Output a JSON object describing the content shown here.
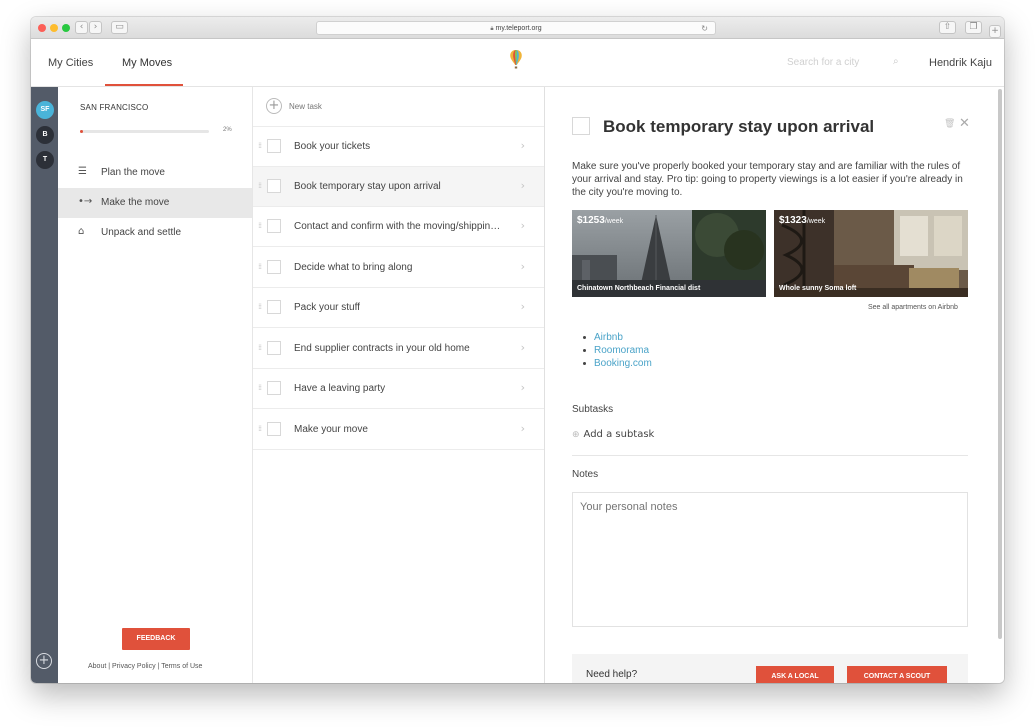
{
  "browser": {
    "url": "my.teleport.org",
    "lock_icon": "lock-icon",
    "reload_icon": "reload-icon"
  },
  "header": {
    "tabs": [
      {
        "label": "My Cities"
      },
      {
        "label": "My Moves"
      }
    ],
    "active_tab": "My Moves",
    "search_placeholder": "Search for a city",
    "user": "Hendrik Kaju"
  },
  "rail": {
    "cities": [
      "SF",
      "B",
      "T"
    ]
  },
  "city": {
    "name": "SAN FRANCISCO",
    "progress_pct": "2%",
    "progress_value": 2,
    "phases": [
      {
        "label": "Plan the move",
        "icon": "list-icon"
      },
      {
        "label": "Make the move",
        "icon": "arrow-icon"
      },
      {
        "label": "Unpack and settle",
        "icon": "home-icon"
      }
    ],
    "active_phase": "Make the move",
    "feedback": "FEEDBACK",
    "footer": {
      "about": "About",
      "privacy": "Privacy Policy",
      "terms": "Terms of Use"
    }
  },
  "tasks": {
    "new_task": "New task",
    "items": [
      {
        "label": "Book your tickets"
      },
      {
        "label": "Book temporary stay upon arrival"
      },
      {
        "label": "Contact and confirm with the moving/shipping company"
      },
      {
        "label": "Decide what to bring along"
      },
      {
        "label": "Pack your stuff"
      },
      {
        "label": "End supplier contracts in your old home"
      },
      {
        "label": "Have a leaving party"
      },
      {
        "label": "Make your move"
      }
    ],
    "active_index": 1
  },
  "detail": {
    "title": "Book temporary stay upon arrival",
    "description": "Make sure you've properly booked your temporary stay and are familiar with the rules of your arrival and stay. Pro tip: going to property viewings is a lot easier if you're already in the city you're moving to.",
    "apartments": [
      {
        "price": "$1253",
        "per": "/week",
        "caption": "Chinatown Northbeach Financial dist"
      },
      {
        "price": "$1323",
        "per": "/week",
        "caption": "Whole sunny Soma loft"
      }
    ],
    "see_all": "See all apartments on Airbnb",
    "links": [
      "Airbnb",
      "Roomorama",
      "Booking.com"
    ],
    "subtasks_heading": "Subtasks",
    "add_subtask": "Add a subtask",
    "notes_heading": "Notes",
    "notes_placeholder": "Your personal notes",
    "help": {
      "label": "Need help?",
      "ask_local": "ASK A LOCAL",
      "contact_scout": "CONTACT A SCOUT"
    }
  },
  "colors": {
    "accent": "#e0513b",
    "link": "#4aa3c8",
    "rail": "#535b68",
    "sf_badge": "#4ab4d9"
  }
}
